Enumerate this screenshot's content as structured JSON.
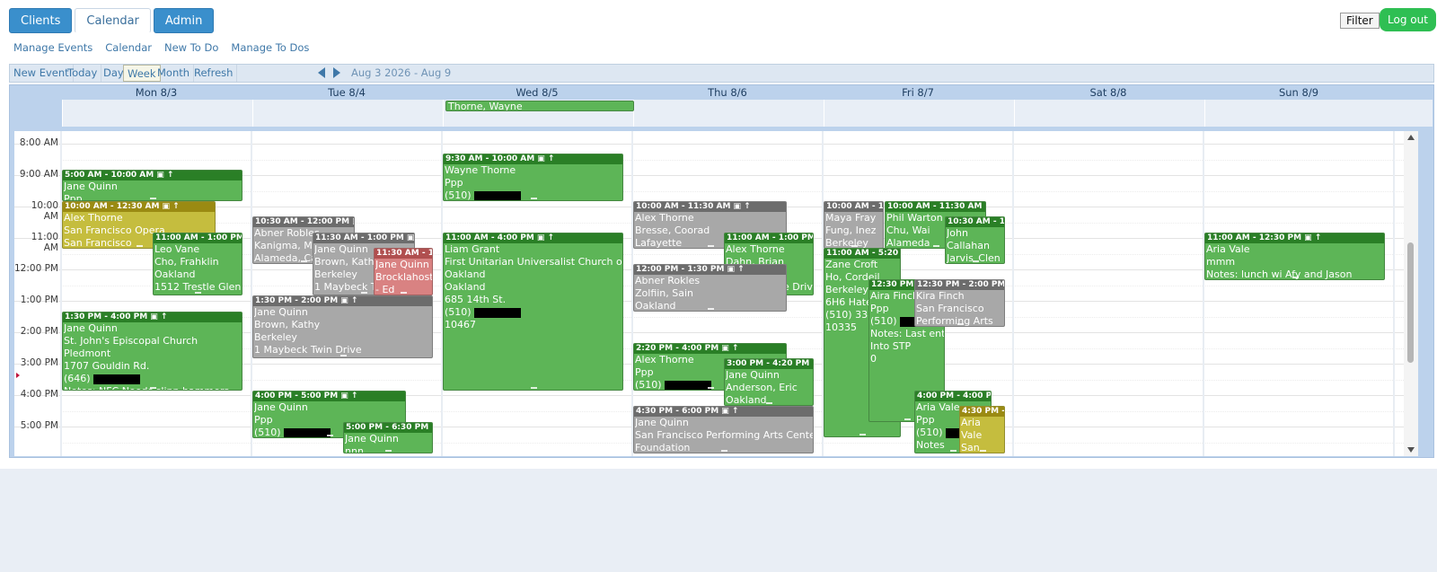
{
  "tabs": [
    {
      "label": "Clients",
      "style": "primary"
    },
    {
      "label": "Calendar",
      "style": "active"
    },
    {
      "label": "Admin",
      "style": "primary"
    }
  ],
  "header": {
    "filter_label": "Filter",
    "logout_label": "Log out"
  },
  "submenu": [
    "Manage Events",
    "Calendar",
    "New To Do",
    "Manage To Dos"
  ],
  "toolbar": {
    "new_event": "New Event",
    "today": "Today",
    "day": "Day",
    "week": "Week",
    "month": "Month",
    "refresh": "Refresh",
    "range": "Aug 3 2026 - Aug 9",
    "selected_view": "week"
  },
  "days": [
    "Mon 8/3",
    "Tue 8/4",
    "Wed 8/5",
    "Thu 8/6",
    "Fri 8/7",
    "Sat 8/8",
    "Sun 8/9"
  ],
  "times": [
    "8:00 AM",
    "9:00 AM",
    "10:00 AM",
    "11:00 AM",
    "12:00 PM",
    "1:00 PM",
    "2:00 PM",
    "3:00 PM",
    "4:00 PM",
    "5:00 PM"
  ],
  "allday_events": [
    {
      "day": 2,
      "title": "Thorne, Wayne",
      "color": "green"
    }
  ],
  "colors": {
    "green": "#5db557",
    "gray": "#a8a8a8",
    "olive": "#c5bd3e",
    "red": "#d98282",
    "tab_blue": "#3a8fcc",
    "logout_green": "#2fbf53"
  },
  "events": [
    {
      "day": 0,
      "header": "5:00 AM - 10:00 AM",
      "lines": [
        "Jane Quinn",
        "Ppp"
      ],
      "color": "green"
    },
    {
      "day": 0,
      "header": "10:00 AM - 12:30 AM",
      "lines": [
        "Alex Thorne",
        "San Francisco Opera",
        "San Francisco"
      ],
      "color": "olive"
    },
    {
      "day": 0,
      "header": "11:00 AM - 1:00 PM",
      "lines": [
        "Leo Vane",
        "Cho, Frahklin",
        "Oakland",
        "1512 Trestle Glen"
      ],
      "color": "green"
    },
    {
      "day": 0,
      "header": "1:30 PM - 4:00 PM",
      "lines": [
        "Jane Quinn",
        "St. John's Episcopal Church",
        "Pledmont",
        "1707 Gouldin Rd.",
        "(646)",
        "Notes: NFC     Needs slipp hammers"
      ],
      "color": "green"
    },
    {
      "day": 1,
      "header": "10:30 AM - 12:00 PM",
      "lines": [
        "Abner Robles",
        "Kanigma, Mal",
        "Alameda, Ca"
      ],
      "color": "gray"
    },
    {
      "day": 1,
      "header": "11:30 AM - 1:00 PM",
      "lines": [
        "Jane Quinn",
        "Brown, Kathy",
        "Berkeley",
        "1 Maybeck T4"
      ],
      "color": "gray"
    },
    {
      "day": 1,
      "header": "11:30 AM - 1:",
      "lines": [
        "Jane Quinn",
        "Brocklahostc",
        "- Ed"
      ],
      "color": "red"
    },
    {
      "day": 1,
      "header": "1:30 PM - 2:00 PM",
      "lines": [
        "Jane Quinn",
        "Brown, Kathy",
        "Berkeley",
        "1 Maybeck Twin Drive"
      ],
      "color": "gray"
    },
    {
      "day": 1,
      "header": "4:00 PM - 5:00 PM",
      "lines": [
        "Jane Quinn",
        "Ppp",
        "(510)"
      ],
      "color": "green"
    },
    {
      "day": 1,
      "header": "5:00 PM - 6:30 PM",
      "lines": [
        "Jane Quinn",
        "nnn"
      ],
      "color": "green"
    },
    {
      "day": 2,
      "header": "9:30 AM - 10:00 AM",
      "lines": [
        "Wayne Thorne",
        "Ppp",
        "(510)"
      ],
      "color": "green"
    },
    {
      "day": 2,
      "header": "11:00 AM - 4:00 PM",
      "lines": [
        "Liam Grant",
        "First Unitarian Universalist Church of",
        "Oakland",
        "Oakland",
        "685 14th St.",
        "(510)",
        "10467"
      ],
      "color": "green"
    },
    {
      "day": 3,
      "header": "10:00 AM - 11:30 AM",
      "lines": [
        "Alex Thorne",
        "Bresse, Coorad",
        "Lafayette"
      ],
      "color": "gray"
    },
    {
      "day": 3,
      "header": "11:00 AM - 1:00 PM",
      "lines": [
        "Alex Thorne",
        "Dahn, Brian",
        "El Sobrante",
        "5803 Skyline Drive"
      ],
      "color": "green"
    },
    {
      "day": 3,
      "header": "12:00 PM - 1:30 PM",
      "lines": [
        "Abner Rokles",
        "Zolfiin, Sain",
        "Oakland"
      ],
      "color": "gray"
    },
    {
      "day": 3,
      "header": "2:20 PM - 4:00 PM",
      "lines": [
        "Alex Thorne",
        "Ppp",
        "(510)"
      ],
      "color": "green"
    },
    {
      "day": 3,
      "header": "3:00 PM - 4:20 PM",
      "lines": [
        "Jane Quinn",
        "Anderson, Eric",
        "Oakland"
      ],
      "color": "green"
    },
    {
      "day": 3,
      "header": "4:30 PM - 6:00 PM",
      "lines": [
        "Jane Quinn",
        "San Francisco Performing Arts Center",
        "Foundation"
      ],
      "color": "gray"
    },
    {
      "day": 4,
      "header": "10:00 AM - 11:",
      "lines": [
        "Maya Fray",
        "Fung, Inez",
        "Berkeley"
      ],
      "color": "gray"
    },
    {
      "day": 4,
      "header": "10:00 AM - 11:30 AM",
      "lines": [
        "Phil Warton",
        "Chu, Wai",
        "Alameda"
      ],
      "color": "green"
    },
    {
      "day": 4,
      "header": "10:30 AM - 12",
      "lines": [
        "John",
        "Callahan",
        "Jarvis_Clen"
      ],
      "color": "green"
    },
    {
      "day": 4,
      "header": "11:00 AM - 5:20",
      "lines": [
        "Zane Croft",
        "Ho, Cordeil",
        "Berkeley",
        "6H6 Hated",
        "(510) 338",
        "10335"
      ],
      "color": "green"
    },
    {
      "day": 4,
      "header": "12:30 PM -",
      "lines": [
        "Aira Finch",
        "Ppp",
        "(510)",
        "Notes: Last entry",
        "Into STP",
        "0"
      ],
      "color": "green"
    },
    {
      "day": 4,
      "header": "12:30 PM - 2:00 PM",
      "lines": [
        "Kira Finch",
        "San Francisco",
        "Performing Arts"
      ],
      "color": "gray"
    },
    {
      "day": 4,
      "header": "4:00 PM - 4:00 PM",
      "lines": [
        "Aria Vale",
        "Ppp",
        "(510)",
        "Notes"
      ],
      "color": "green"
    },
    {
      "day": 4,
      "header": "4:30 PM - 6",
      "lines": [
        "Aria",
        "Vale",
        "San"
      ],
      "color": "olive"
    },
    {
      "day": 6,
      "header": "11:00 AM - 12:30 PM",
      "lines": [
        "Aria Vale",
        "mmm",
        "Notes: lunch wi Afy and Jason"
      ],
      "color": "green"
    }
  ]
}
